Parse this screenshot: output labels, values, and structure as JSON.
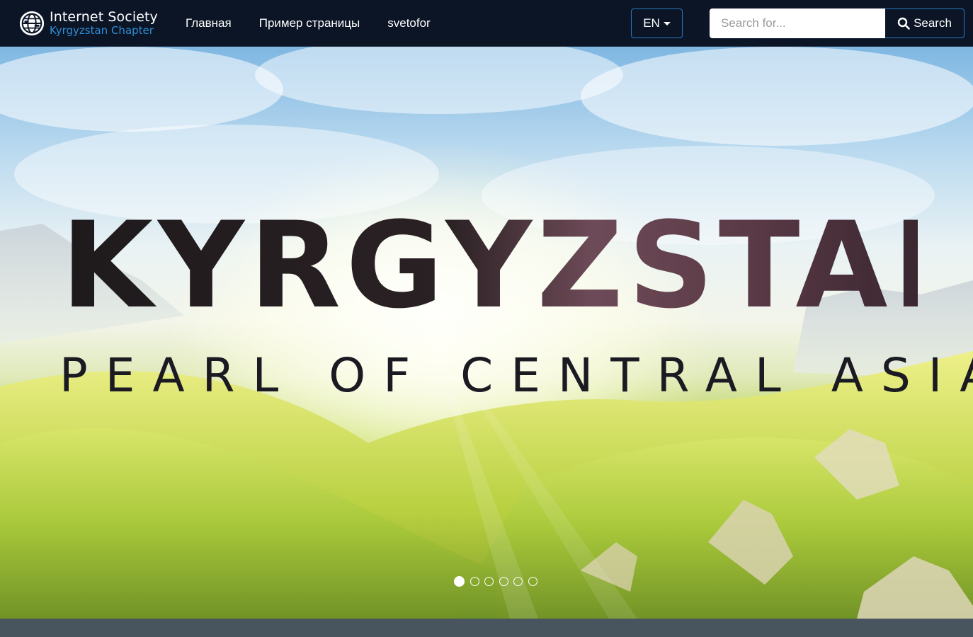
{
  "brand": {
    "line1": "Internet Society",
    "line2": "Kyrgyzstan Chapter",
    "logo_icon": "globe-logo-icon"
  },
  "nav": {
    "links": [
      "Главная",
      "Пример страницы",
      "svetofor"
    ]
  },
  "language": {
    "selected": "EN"
  },
  "search": {
    "placeholder": "Search for...",
    "button_label": "Search",
    "icon": "search-icon"
  },
  "hero": {
    "title": "KYRGYZSTAN",
    "subtitle": "PEARL OF CENTRAL ASIA",
    "slide_count": 6,
    "active_slide": 1
  },
  "colors": {
    "navbar_bg": "#0b1526",
    "accent_blue": "#2a77c2",
    "brand_blue": "#2e8fd8",
    "footer_strip": "#48545e"
  }
}
